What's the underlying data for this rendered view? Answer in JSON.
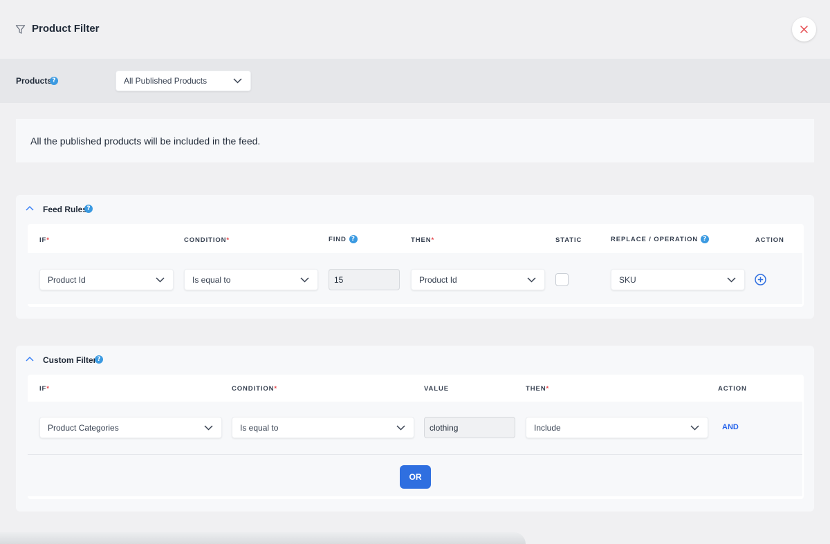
{
  "header": {
    "title": "Product Filter"
  },
  "products": {
    "label": "Products",
    "selected": "All Published Products"
  },
  "info": {
    "message": "All the published products will be included in the feed."
  },
  "feed_rules": {
    "title": "Feed Rules",
    "columns": {
      "if": "IF",
      "condition": "CONDITION",
      "find": "FIND",
      "then": "THEN",
      "static": "STATIC",
      "replace": "REPLACE / OPERATION",
      "action": "ACTION"
    },
    "required_mark": "*",
    "row": {
      "if": "Product Id",
      "condition": "Is equal to",
      "find": "15",
      "then": "Product Id",
      "static_checked": false,
      "replace": "SKU"
    }
  },
  "custom_filter": {
    "title": "Custom Filter",
    "columns": {
      "if": "IF",
      "condition": "CONDITION",
      "value": "VALUE",
      "then": "THEN",
      "action": "ACTION"
    },
    "required_mark": "*",
    "row": {
      "if": "Product Categories",
      "condition": "Is equal to",
      "value": "clothing",
      "then": "Include",
      "action": "AND"
    },
    "or_label": "OR"
  },
  "colors": {
    "accent": "#2f6fe0",
    "help": "#3b9ae1",
    "required": "#e5484d",
    "close": "#e5484d"
  }
}
